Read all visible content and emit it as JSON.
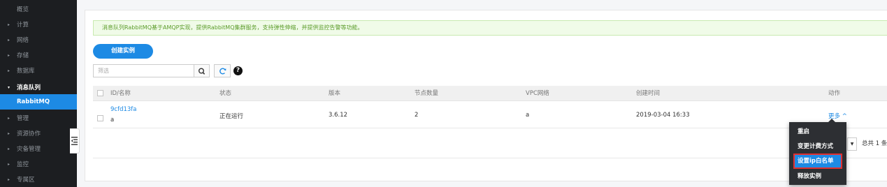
{
  "sidebar": {
    "items": [
      {
        "label": "概览",
        "has_caret": false
      },
      {
        "label": "计算",
        "has_caret": true
      },
      {
        "label": "网络",
        "has_caret": true
      },
      {
        "label": "存储",
        "has_caret": true
      },
      {
        "label": "数据库",
        "has_caret": true
      },
      {
        "label": "消息队列",
        "has_caret": true,
        "expanded": true
      },
      {
        "label": "RabbitMQ",
        "active": true
      },
      {
        "label": "管理",
        "has_caret": true
      },
      {
        "label": "资源协作",
        "has_caret": true
      },
      {
        "label": "灾备管理",
        "has_caret": true
      },
      {
        "label": "监控",
        "has_caret": true
      },
      {
        "label": "专属区",
        "has_caret": true
      }
    ],
    "caret_right": "▸",
    "caret_down": "▾"
  },
  "notice": "消息队列RabbitMQ基于AMQP实现，提供RabbitMQ集群服务，支持弹性伸缩，并提供监控告警等功能。",
  "toolbar": {
    "create_label": "创建实例",
    "filter_placeholder": "筛选",
    "help_glyph": "?"
  },
  "table": {
    "columns": [
      "ID/名称",
      "状态",
      "版本",
      "节点数量",
      "VPC网络",
      "创建时间",
      "动作"
    ],
    "rows": [
      {
        "id": "9cfd13fa",
        "name": "a",
        "status": "正在运行",
        "version": "3.6.12",
        "nodes": "2",
        "vpc": "a",
        "created": "2019-03-04 16:33",
        "action": "更多 ^"
      }
    ]
  },
  "pagination": {
    "select_glyph": "▼",
    "total": "总共 1 条"
  },
  "dropdown": {
    "items": [
      "重启",
      "变更计费方式",
      "设置ip白名单",
      "释放实例"
    ],
    "highlighted_index": 2
  },
  "colors": {
    "sidebar_bg": "#1c1e21",
    "accent": "#1d8ae4",
    "notice_bg": "#f0fbe8",
    "notice_text": "#5b9c2a",
    "dropdown_bg": "#2d2f33",
    "highlight_border": "#e03030"
  }
}
